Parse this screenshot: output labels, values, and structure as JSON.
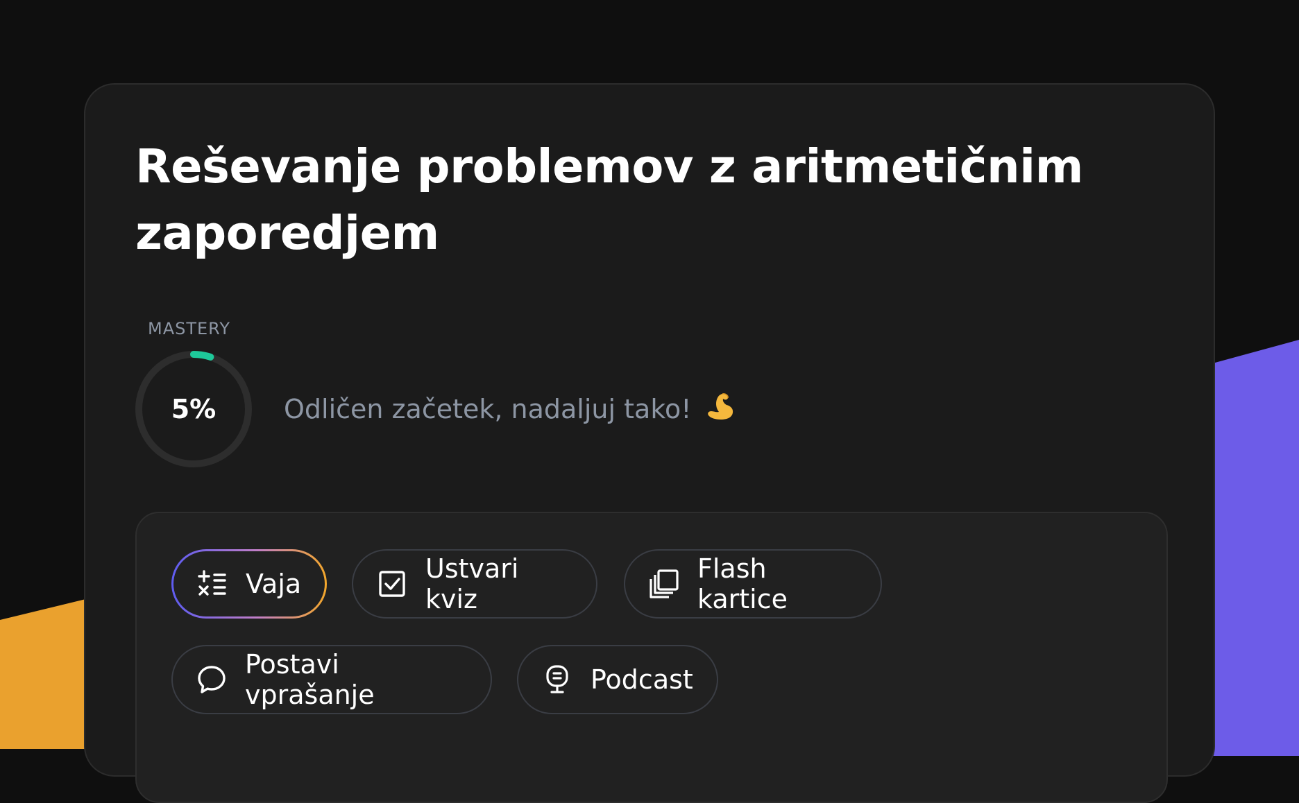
{
  "lesson": {
    "title": "Reševanje problemov z aritmetičnim zaporedjem"
  },
  "mastery": {
    "label": "MASTERY",
    "percent_text": "5%",
    "progress": 0.05,
    "message": "Odličen začetek, nadaljuj tako!",
    "message_icon": "flexed-biceps-icon",
    "accent_color": "#1ec99a"
  },
  "actions": [
    {
      "label": "Vaja",
      "icon": "math-operations-icon",
      "active": true
    },
    {
      "label": "Ustvari kviz",
      "icon": "checkbox-icon",
      "active": false
    },
    {
      "label": "Flash kartice",
      "icon": "stacked-cards-icon",
      "active": false
    },
    {
      "label": "Postavi vprašanje",
      "icon": "speech-bubble-icon",
      "active": false
    },
    {
      "label": "Podcast",
      "icon": "microphone-icon",
      "active": false
    }
  ],
  "colors": {
    "page_background": "#0f0f0f",
    "card_background": "#1b1b1b",
    "accent_orange": "#eaa12e",
    "accent_purple": "#6d5ce8"
  }
}
